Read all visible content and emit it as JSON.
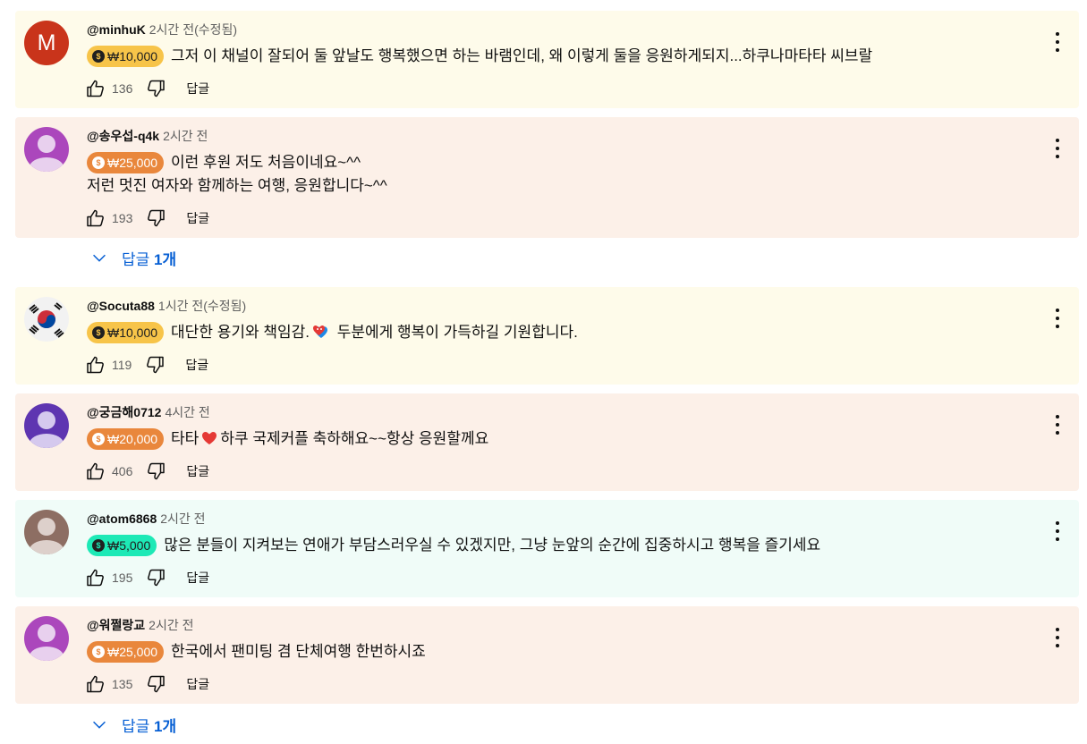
{
  "comments": [
    {
      "author": "@minhuK",
      "time": "2시간 전(수정됨)",
      "avatar_letter": "M",
      "avatar_color": "#c9341b",
      "donation": "₩10,000",
      "donation_color": "#f7c449",
      "lines": [
        "그저 이 채널이 잘되어 둘 앞날도 행복했으면 하는 바램인데, 왜 이렇게 둘을 응원하게되지...하쿠나마타타 씨브랄"
      ],
      "likes": "136",
      "reply_label": "답글"
    },
    {
      "author": "@송우섭-q4k",
      "time": "2시간 전",
      "avatar_color": "#ab47bc",
      "donation": "₩25,000",
      "donation_color": "#e9873c",
      "lines": [
        "이런 후원 저도 처음이네요~^^",
        "저런 멋진 여자와 함께하는 여행, 응원합니다~^^"
      ],
      "likes": "193",
      "reply_label": "답글"
    },
    {
      "author": "@Socuta88",
      "time": "1시간 전(수정됨)",
      "avatar_color": "#f2f2f2",
      "donation": "₩10,000",
      "donation_color": "#f7c449",
      "line_before_emoji": "대단한 용기와 책임감.",
      "emoji": "blue-heart-emoji",
      "line_after_emoji": " 두분에게 행복이 가득하길 기원합니다.",
      "likes": "119",
      "reply_label": "답글"
    },
    {
      "author": "@궁금해0712",
      "time": "4시간 전",
      "avatar_color": "#5e35b1",
      "donation": "₩20,000",
      "donation_color": "#e9873c",
      "line_before_emoji": "타타",
      "emoji": "red-heart-emoji",
      "line_after_emoji": "하쿠 국제커플 축하해요~~항상 응원할께요",
      "likes": "406",
      "reply_label": "답글"
    },
    {
      "author": "@atom6868",
      "time": "2시간 전",
      "avatar_color": "#8d6e63",
      "donation": "₩5,000",
      "donation_color": "#1de9b6",
      "lines": [
        "많은 분들이 지켜보는 연애가 부담스러우실 수 있겠지만, 그냥 눈앞의 순간에 집중하시고 행복을 즐기세요"
      ],
      "likes": "195",
      "reply_label": "답글"
    },
    {
      "author": "@워쩔랑교",
      "time": "2시간 전",
      "avatar_color": "#ab47bc",
      "donation": "₩25,000",
      "donation_color": "#e9873c",
      "lines": [
        "한국에서 팬미팅 겸 단체여행 한번하시죠"
      ],
      "likes": "135",
      "reply_label": "답글"
    }
  ],
  "replies_toggles": [
    {
      "label": "답글",
      "count": "1개"
    },
    {
      "label": "답글",
      "count": "1개"
    }
  ],
  "icons": {
    "like": "thumb-up-icon",
    "dislike": "thumb-down-icon",
    "more": "more-vertical-icon",
    "expand": "chevron-down-icon",
    "coin": "super-thanks-coin-icon"
  }
}
